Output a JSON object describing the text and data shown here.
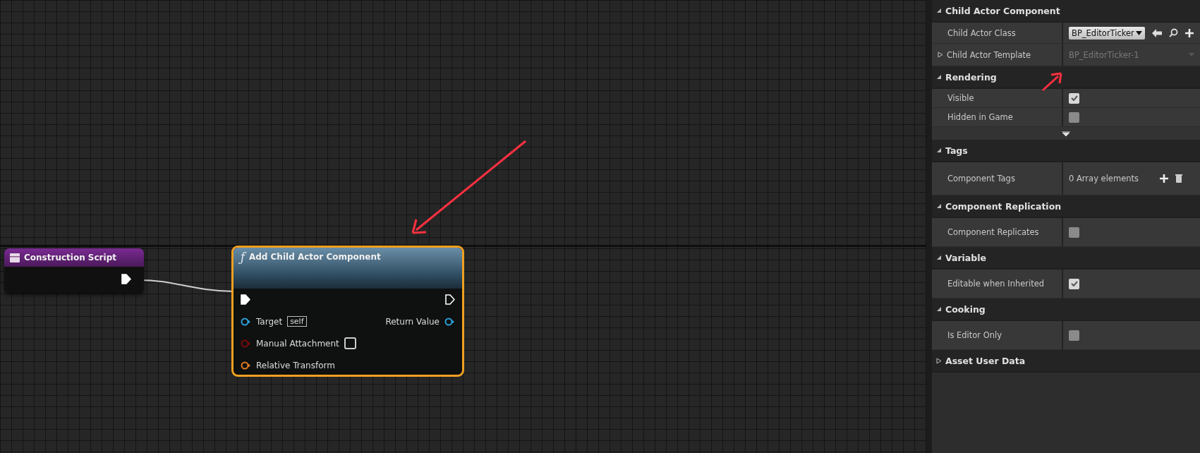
{
  "graph": {
    "event_node": {
      "title": "Construction Script"
    },
    "function_node": {
      "title": "Add Child Actor Component",
      "icon": "ƒ",
      "selected": true,
      "pins": [
        {
          "kind": "exec_in"
        },
        {
          "kind": "object",
          "label": "Target",
          "value": "self",
          "output_label": "Return Value"
        },
        {
          "kind": "bool",
          "label": "Manual Attachment",
          "checked": false
        },
        {
          "kind": "struct",
          "label": "Relative Transform"
        }
      ]
    }
  },
  "details": {
    "sections": [
      {
        "title": "Child Actor Component",
        "expanded": true,
        "rows": [
          {
            "kind": "asset",
            "label": "Child Actor Class",
            "value": "BP_EditorTicker"
          },
          {
            "kind": "template",
            "label": "Child Actor Template",
            "expanded": false,
            "value": "BP_EditorTicker-1"
          }
        ]
      },
      {
        "title": "Rendering",
        "expanded": true,
        "advanced": true,
        "rows": [
          {
            "kind": "checkbox",
            "label": "Visible",
            "checked": true
          },
          {
            "kind": "checkbox",
            "label": "Hidden in Game",
            "checked": false
          }
        ]
      },
      {
        "title": "Tags",
        "expanded": true,
        "rows": [
          {
            "kind": "array",
            "label": "Component Tags",
            "value": "0 Array elements"
          }
        ]
      },
      {
        "title": "Component Replication",
        "expanded": true,
        "rows": [
          {
            "kind": "checkbox",
            "label": "Component Replicates",
            "checked": false
          }
        ]
      },
      {
        "title": "Variable",
        "expanded": true,
        "rows": [
          {
            "kind": "checkbox",
            "label": "Editable when Inherited",
            "checked": true
          }
        ]
      },
      {
        "title": "Cooking",
        "expanded": true,
        "rows": [
          {
            "kind": "checkbox",
            "label": "Is Editor Only",
            "checked": false
          }
        ]
      },
      {
        "title": "Asset User Data",
        "expanded": false
      }
    ]
  }
}
